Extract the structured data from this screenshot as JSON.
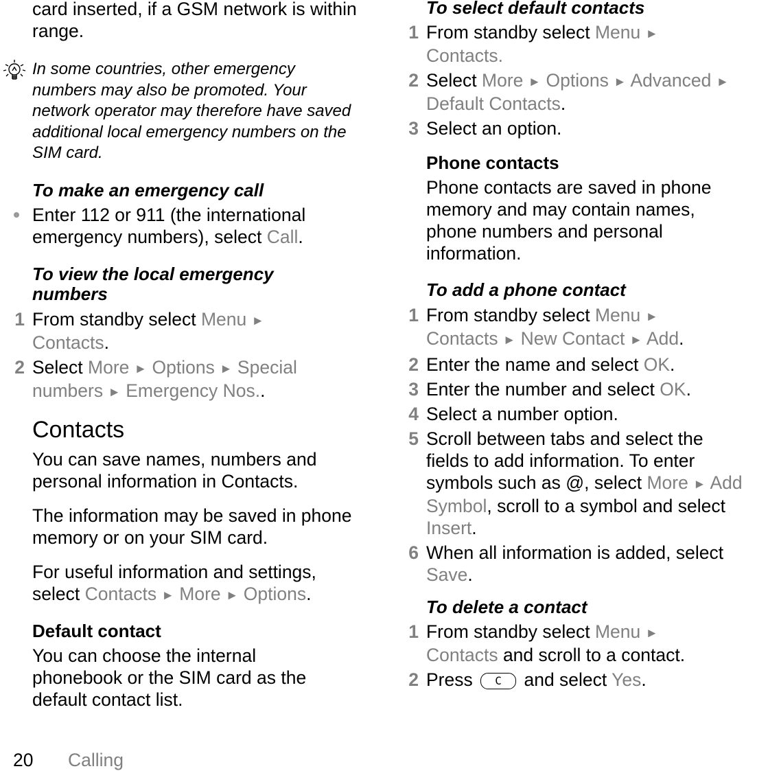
{
  "left": {
    "intro": "card inserted, if a GSM network is within range.",
    "note": {
      "icon": "lightbulb-icon",
      "text": "In some countries, other emergency numbers may also be promoted. Your network operator may therefore have saved additional local emergency numbers on the SIM card."
    },
    "emergency_call": {
      "heading": "To make an emergency call",
      "bullet_text": "Enter 112 or 911 (the international emergency numbers), select ",
      "bullet_link": "Call",
      "bullet_end": "."
    },
    "local_numbers": {
      "heading": "To view the local emergency numbers",
      "steps": [
        {
          "num": "1",
          "pre": "From standby select ",
          "path": [
            "Menu",
            "Contacts"
          ],
          "post": "."
        },
        {
          "num": "2",
          "pre": "Select ",
          "path": [
            "More",
            "Options",
            "Special numbers",
            "Emergency Nos."
          ],
          "post": "."
        }
      ]
    },
    "contacts": {
      "title": "Contacts",
      "p1": "You can save names, numbers and personal information in Contacts.",
      "p2": "The information may be saved in phone memory or on your SIM card.",
      "p3_pre": "For useful information and settings, select ",
      "p3_path": [
        "Contacts",
        "More",
        "Options"
      ],
      "p3_post": "."
    },
    "default_contact": {
      "heading": "Default contact",
      "text": "You can choose the internal phonebook or the SIM card as the default contact list."
    }
  },
  "right": {
    "select_default": {
      "heading": "To select default contacts",
      "steps": [
        {
          "num": "1",
          "pre": "From standby select ",
          "path": [
            "Menu",
            "Contacts."
          ],
          "post": ""
        },
        {
          "num": "2",
          "pre": "Select ",
          "path": [
            "More",
            "Options",
            "Advanced",
            "Default Contacts"
          ],
          "post": "."
        },
        {
          "num": "3",
          "text": "Select an option."
        }
      ]
    },
    "phone_contacts": {
      "heading": "Phone contacts",
      "text": "Phone contacts are saved in phone memory and may contain names, phone numbers and personal information."
    },
    "add_contact": {
      "heading": "To add a phone contact",
      "steps": [
        {
          "num": "1",
          "pre": "From standby select ",
          "path": [
            "Menu",
            "Contacts",
            "New Contact",
            "Add"
          ],
          "post": "."
        },
        {
          "num": "2",
          "pre": "Enter the name and select ",
          "link": "OK",
          "post": "."
        },
        {
          "num": "3",
          "pre": "Enter the number and select ",
          "link": "OK",
          "post": "."
        },
        {
          "num": "4",
          "text": "Select a number option."
        },
        {
          "num": "5",
          "pre": "Scroll between tabs and select the fields to add information. To enter symbols such as @, select ",
          "path": [
            "More",
            "Add Symbol"
          ],
          "mid": ", scroll to a symbol and select ",
          "link": "Insert",
          "post": "."
        },
        {
          "num": "6",
          "pre": "When all information is added, select ",
          "link": "Save",
          "post": "."
        }
      ]
    },
    "delete_contact": {
      "heading": "To delete a contact",
      "steps": [
        {
          "num": "1",
          "pre": "From standby select ",
          "path": [
            "Menu",
            "Contacts"
          ],
          "post": " and scroll to a contact."
        },
        {
          "num": "2",
          "pre": "Press ",
          "key": "C",
          "mid": " and select ",
          "link": "Yes",
          "post": "."
        }
      ]
    }
  },
  "footer": {
    "page_number": "20",
    "section": "Calling"
  },
  "colors": {
    "text": "#000000",
    "menu_gray": "#808080"
  },
  "arrow_glyph": "►"
}
